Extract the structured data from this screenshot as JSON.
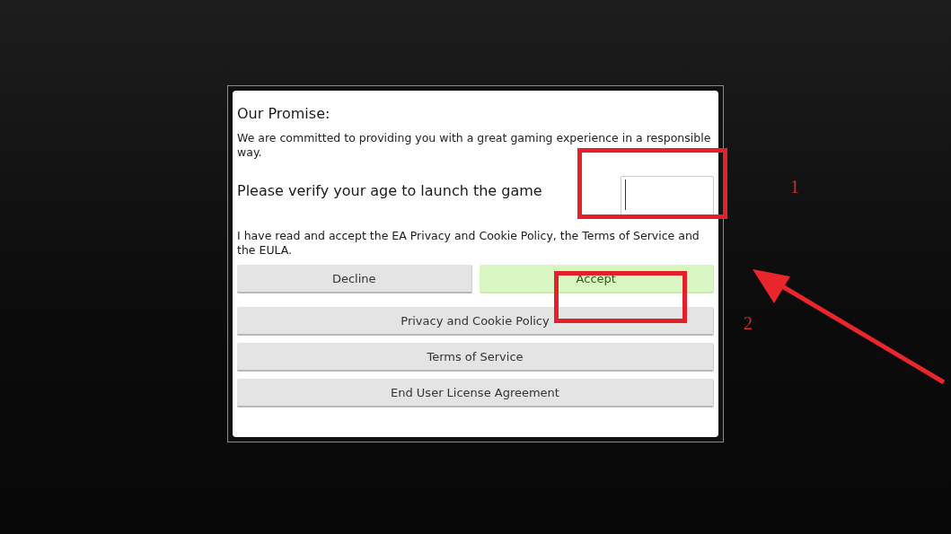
{
  "dialog": {
    "heading": "Our Promise:",
    "intro": "We are committed to providing you with a great gaming experience in a responsible way.",
    "age_prompt": "Please verify your age to launch the game",
    "consent": "I have read and accept the EA Privacy and Cookie Policy, the Terms of Service and the EULA.",
    "choice_buttons": [
      {
        "label": "Decline",
        "kind": "neutral"
      },
      {
        "label": "Accept",
        "kind": "positive"
      }
    ],
    "link_buttons": [
      {
        "label": "Privacy and Cookie Policy"
      },
      {
        "label": "Terms of Service"
      },
      {
        "label": "End User License Agreement"
      }
    ]
  },
  "annotations": {
    "labels": [
      {
        "text": "1"
      },
      {
        "text": "2"
      }
    ]
  }
}
